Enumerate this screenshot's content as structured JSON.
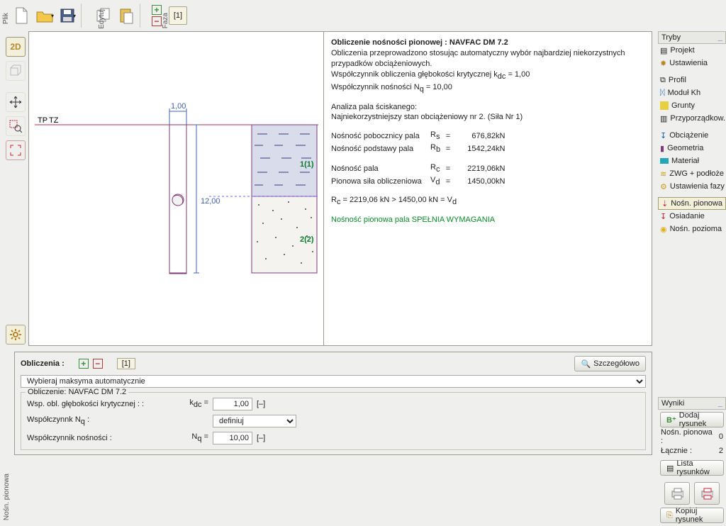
{
  "toolbar_vert": {
    "plik": "Plik",
    "edytuj": "Edytuj",
    "faza": "Faza"
  },
  "tabs": {
    "one": "[1]"
  },
  "left_status": "Nośn. pionowa",
  "left_tools": {
    "view2d": "2D",
    "view3d": "3D"
  },
  "drawing": {
    "tp": "TP",
    "tz": "TZ",
    "dim_top": "1,00",
    "dim_v": "12,00",
    "z1": "1(1)",
    "z2": "2(2)"
  },
  "res": {
    "title": "Obliczenie nośności pionowej : NAVFAC DM 7.2",
    "l1": "Obliczenia przeprowadzono stosując automatyczny wybór najbardziej niekorzystnych przypadków obciążeniowych.",
    "l2a": "Współczynnik obliczenia głębokości krytycznej k",
    "l2sub": "dc",
    "l2b": " = 1,00",
    "l3a": "Współczynnik nośności N",
    "l3sub": "q",
    "l3b": " = 10,00",
    "a1": "Analiza pala ściskanego:",
    "a2": "Najniekorzystniejszy stan obciążeniowy nr 2. (Siła Nr 1)",
    "r1a": "Nośność pobocznicy pala",
    "r1s": "R",
    "r1sub": "s",
    "r1eq": "=",
    "r1v": "676,82",
    "r1u": " kN",
    "r2a": "Nośność podstawy pala",
    "r2s": "R",
    "r2sub": "b",
    "r2eq": "=",
    "r2v": "1542,24",
    "r2u": " kN",
    "r3a": "Nośność pala",
    "r3s": "R",
    "r3sub": "c",
    "r3eq": "=",
    "r3v": "2219,06",
    "r3u": " kN",
    "r4a": "Pionowa siła obliczeniowa",
    "r4s": "V",
    "r4sub": "d",
    "r4eq": "=",
    "r4v": "1450,00",
    "r4u": " kN",
    "cmp": "R_c = 2219,06 kN > 1450,00 kN = V_d",
    "ok": "Nośność pionowa pala SPEŁNIA WYMAGANIA"
  },
  "tryby": {
    "hdr": "Tryby",
    "items": [
      "Projekt",
      "Ustawienia",
      "Profil",
      "Moduł Kh",
      "Grunty",
      "Przyporządkow.",
      "Obciążenie",
      "Geometria",
      "Materiał",
      "ZWG + podłoże",
      "Ustawienia fazy",
      "Nośn. pionowa",
      "Osiadanie",
      "Nośn. pozioma"
    ]
  },
  "wyniki": {
    "hdr": "Wyniki",
    "dodaj": "Dodaj rysunek",
    "l1": "Nośn. pionowa :",
    "v1": "0",
    "l2": "Łącznie :",
    "v2": "2",
    "lista": "Lista rysunków",
    "kopiuj": "Kopiuj rysunek"
  },
  "calc": {
    "hdr": "Obliczenia :",
    "phase": "[1]",
    "szcz": "Szczegółowo",
    "wyb": "Wybieraj maksyma automatycznie",
    "grp": "Obliczenie: NAVFAC DM 7.2",
    "f1": "Wsp. obl. głębokości krytycznej : :",
    "f1s": "k",
    "f1sub": "dc",
    "f1eq": "=",
    "f1v": "1,00",
    "f1u": "[–]",
    "f2": "Współczynnk N",
    "f2sub": "q",
    "f2colon": " :",
    "f2sel": "definiuj",
    "f3": "Współczynnik nośności :",
    "f3s": "N",
    "f3sub": "q",
    "f3eq": "=",
    "f3v": "10,00",
    "f3u": "[–]"
  }
}
